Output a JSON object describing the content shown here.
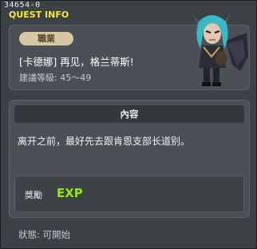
{
  "window": {
    "quest_code": "34654-0",
    "title": "QUEST INFO"
  },
  "header": {
    "job_tag": "職業",
    "quest_name": "[卡德娜] 再见，格兰蒂斯!",
    "level_requirement": "建議等級: 45～49"
  },
  "content": {
    "section_title": "內容",
    "description": "离开之前，最好先去跟肯恩支部长道别。"
  },
  "reward": {
    "label": "獎勵",
    "exp_label": "EXP"
  },
  "status": {
    "text": "狀態: 可開始"
  },
  "colors": {
    "title_yellow": "#f2e65a",
    "panel_bg": "#4a5056",
    "exp_green": "#9be12a"
  }
}
